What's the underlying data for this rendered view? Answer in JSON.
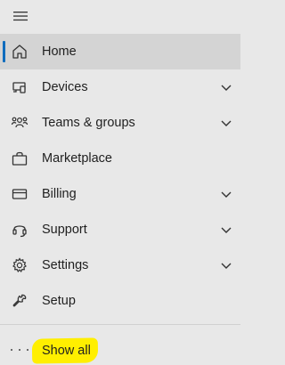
{
  "nav": {
    "items": [
      {
        "label": "Home",
        "icon": "home-icon",
        "active": true,
        "expandable": false
      },
      {
        "label": "Devices",
        "icon": "devices-icon",
        "active": false,
        "expandable": true
      },
      {
        "label": "Teams & groups",
        "icon": "teams-groups-icon",
        "active": false,
        "expandable": true
      },
      {
        "label": "Marketplace",
        "icon": "shopping-bag-icon",
        "active": false,
        "expandable": false
      },
      {
        "label": "Billing",
        "icon": "credit-card-icon",
        "active": false,
        "expandable": true
      },
      {
        "label": "Support",
        "icon": "headset-icon",
        "active": false,
        "expandable": true
      },
      {
        "label": "Settings",
        "icon": "gear-icon",
        "active": false,
        "expandable": true
      },
      {
        "label": "Setup",
        "icon": "wrench-icon",
        "active": false,
        "expandable": false
      }
    ],
    "show_all_label": "Show all"
  },
  "colors": {
    "background": "#e8e8e8",
    "active_background": "#d4d4d4",
    "accent": "#0f6cbd",
    "highlight": "#ffef00"
  }
}
